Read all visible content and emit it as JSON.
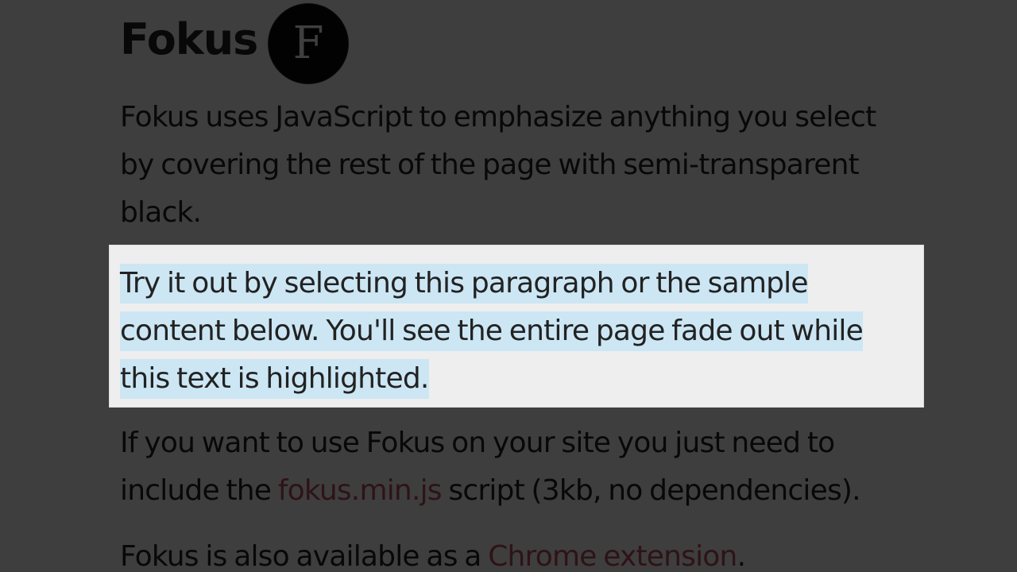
{
  "header": {
    "title": "Fokus",
    "logo_letter": "F"
  },
  "paragraphs": {
    "intro": "Fokus uses JavaScript to emphasize anything you select by covering the rest of the page with semi-transparent black.",
    "selected": "Try it out by selecting this paragraph or the sample content below. You'll see the entire page fade out while this text is highlighted.",
    "usage_before": "If you want to use Fokus on your site you just need to include the ",
    "usage_link": "fokus.min.js",
    "usage_after": " script (3kb, no dependencies).",
    "extension_before": "Fokus is also available as a ",
    "extension_link": "Chrome extension",
    "extension_after": "."
  },
  "colors": {
    "page_background": "#eeeeee",
    "overlay": "rgba(0,0,0,0.74)",
    "selection": "#cce6f4",
    "link": "#b04a5a",
    "text": "#222222"
  }
}
